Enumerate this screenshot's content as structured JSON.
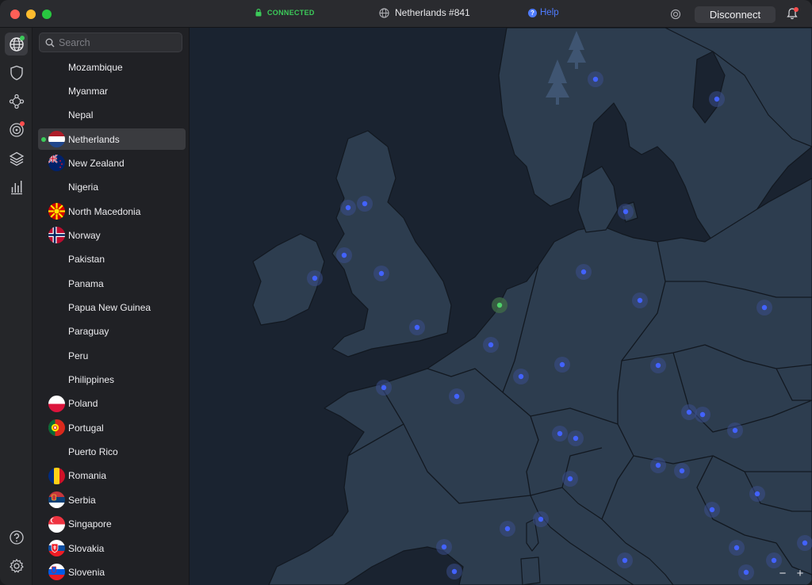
{
  "titlebar": {
    "status": "CONNECTED",
    "server": "Netherlands #841",
    "help": "Help",
    "disconnect": "Disconnect"
  },
  "rail": {
    "items": [
      "globe-icon",
      "shield-icon",
      "meshnet-icon",
      "threat-protection-icon",
      "layers-icon",
      "stats-icon"
    ],
    "bottom": [
      "help-icon",
      "settings-icon"
    ]
  },
  "search": {
    "placeholder": "Search"
  },
  "countries": [
    {
      "name": "Mozambique",
      "flag": ""
    },
    {
      "name": "Myanmar",
      "flag": ""
    },
    {
      "name": "Nepal",
      "flag": ""
    },
    {
      "name": "Netherlands",
      "flag": "nl",
      "selected": true,
      "connected": true
    },
    {
      "name": "New Zealand",
      "flag": "nz"
    },
    {
      "name": "Nigeria",
      "flag": ""
    },
    {
      "name": "North Macedonia",
      "flag": "mk"
    },
    {
      "name": "Norway",
      "flag": "no"
    },
    {
      "name": "Pakistan",
      "flag": ""
    },
    {
      "name": "Panama",
      "flag": ""
    },
    {
      "name": "Papua New Guinea",
      "flag": ""
    },
    {
      "name": "Paraguay",
      "flag": ""
    },
    {
      "name": "Peru",
      "flag": ""
    },
    {
      "name": "Philippines",
      "flag": ""
    },
    {
      "name": "Poland",
      "flag": "pl"
    },
    {
      "name": "Portugal",
      "flag": "pt"
    },
    {
      "name": "Puerto Rico",
      "flag": ""
    },
    {
      "name": "Romania",
      "flag": "ro"
    },
    {
      "name": "Serbia",
      "flag": "rs"
    },
    {
      "name": "Singapore",
      "flag": "sg"
    },
    {
      "name": "Slovakia",
      "flag": "sk"
    },
    {
      "name": "Slovenia",
      "flag": "si"
    }
  ],
  "map": {
    "zoom_out": "−",
    "zoom_in": "+",
    "colors": {
      "sea": "#1a2330",
      "land": "#2d3d4f",
      "server": "#4262ff",
      "active": "#4fd26a"
    }
  }
}
